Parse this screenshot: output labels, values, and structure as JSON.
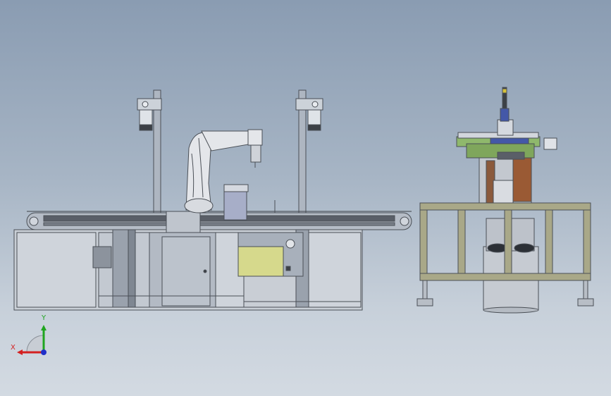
{
  "viewport": {
    "background_top": "#8a9cb2",
    "background_bottom": "#d3dae2"
  },
  "triad": {
    "x_label": "X",
    "y_label": "Y",
    "x_color": "#d42020",
    "y_color": "#1fa51f",
    "z_color": "#2030c8"
  },
  "colors": {
    "frame_line": "#4a4f56",
    "frame_fill": "#c6ccd4",
    "panel_fill": "#b7bec8",
    "conveyor_dark": "#50545c",
    "robot_fill": "#e4e6ea",
    "olive_box": "#d6d98c",
    "station_frame": "#a9a888",
    "station_green": "#8fb86c",
    "copper": "#9a5a34",
    "blue_part": "#4458a8",
    "cylinder_fill": "#c8cdd4"
  }
}
